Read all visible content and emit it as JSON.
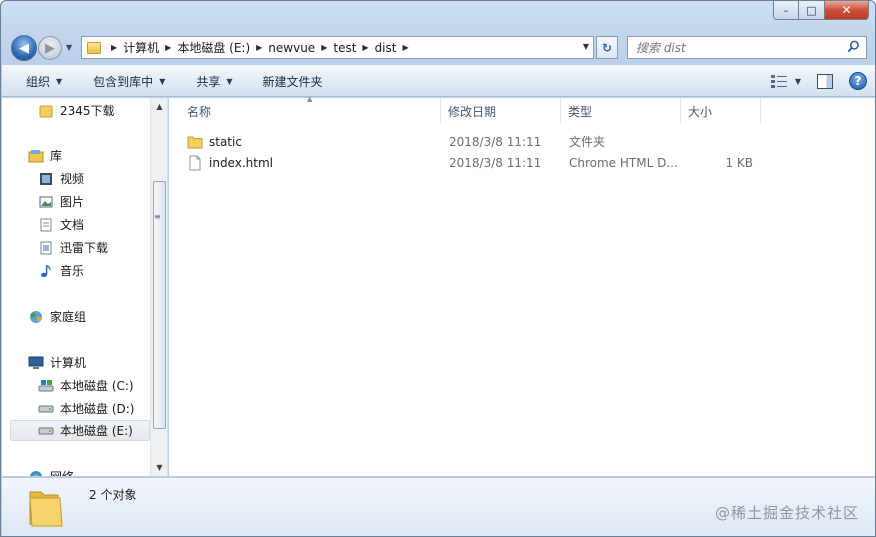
{
  "window": {
    "caption_buttons": {
      "minimize": "–",
      "maximize": "□",
      "close": "✕"
    }
  },
  "nav": {
    "back_glyph": "◀",
    "forward_glyph": "▶",
    "breadcrumbs": [
      "计算机",
      "本地磁盘 (E:)",
      "newvue",
      "test",
      "dist"
    ],
    "search_placeholder": "搜索 dist",
    "refresh_glyph": "↻"
  },
  "toolbar": {
    "organize": "组织",
    "include_in_library": "包含到库中",
    "share": "共享",
    "new_folder": "新建文件夹",
    "help": "?"
  },
  "sidebar": {
    "items": [
      {
        "label": "2345下载",
        "icon": "folder-icon"
      },
      {
        "label": "库",
        "icon": "library-icon"
      },
      {
        "label": "视频",
        "icon": "video-icon"
      },
      {
        "label": "图片",
        "icon": "picture-icon"
      },
      {
        "label": "文档",
        "icon": "document-icon"
      },
      {
        "label": "迅雷下载",
        "icon": "download-icon"
      },
      {
        "label": "音乐",
        "icon": "music-icon"
      },
      {
        "label": "家庭组",
        "icon": "homegroup-icon"
      },
      {
        "label": "计算机",
        "icon": "computer-icon"
      },
      {
        "label": "本地磁盘 (C:)",
        "icon": "drive-c-icon"
      },
      {
        "label": "本地磁盘 (D:)",
        "icon": "drive-icon"
      },
      {
        "label": "本地磁盘 (E:)",
        "icon": "drive-icon"
      },
      {
        "label": "网络",
        "icon": "network-icon"
      }
    ]
  },
  "columns": {
    "name": "名称",
    "modified": "修改日期",
    "type": "类型",
    "size": "大小"
  },
  "files": [
    {
      "name": "static",
      "modified": "2018/3/8 11:11",
      "type": "文件夹",
      "size": ""
    },
    {
      "name": "index.html",
      "modified": "2018/3/8 11:11",
      "type": "Chrome HTML D...",
      "size": "1 KB"
    }
  ],
  "status": {
    "count": "2 个对象"
  },
  "watermark": "@稀土掘金技术社区",
  "colors": {
    "accent": "#2f69b5",
    "close": "#c8503b"
  }
}
